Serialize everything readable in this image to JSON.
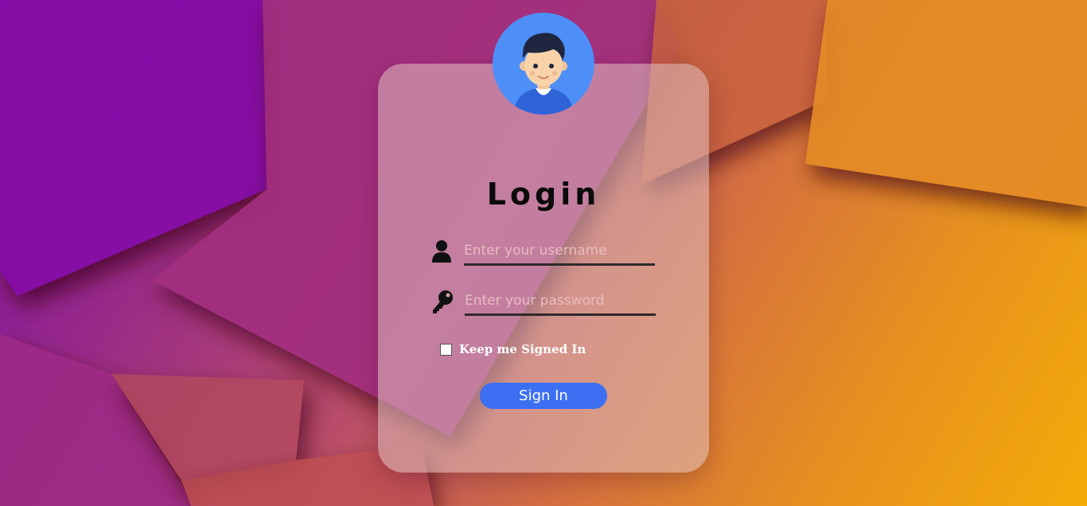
{
  "login": {
    "title": "Login",
    "username": {
      "icon": "user-icon",
      "value": "",
      "placeholder": "Enter your username"
    },
    "password": {
      "icon": "key-icon",
      "value": "",
      "placeholder": "Enter your password"
    },
    "keep_signed_in": {
      "label": "Keep me Signed In",
      "checked": false
    },
    "submit_label": "Sign In",
    "avatar_icon": "user-avatar-icon"
  },
  "colors": {
    "button": "#3c6ff2",
    "avatar_bg": "#4d8ff7",
    "card_bg": "rgba(220,190,190,0.55)",
    "gradient_start": "#7d0ca8",
    "gradient_end": "#f6ab08"
  }
}
